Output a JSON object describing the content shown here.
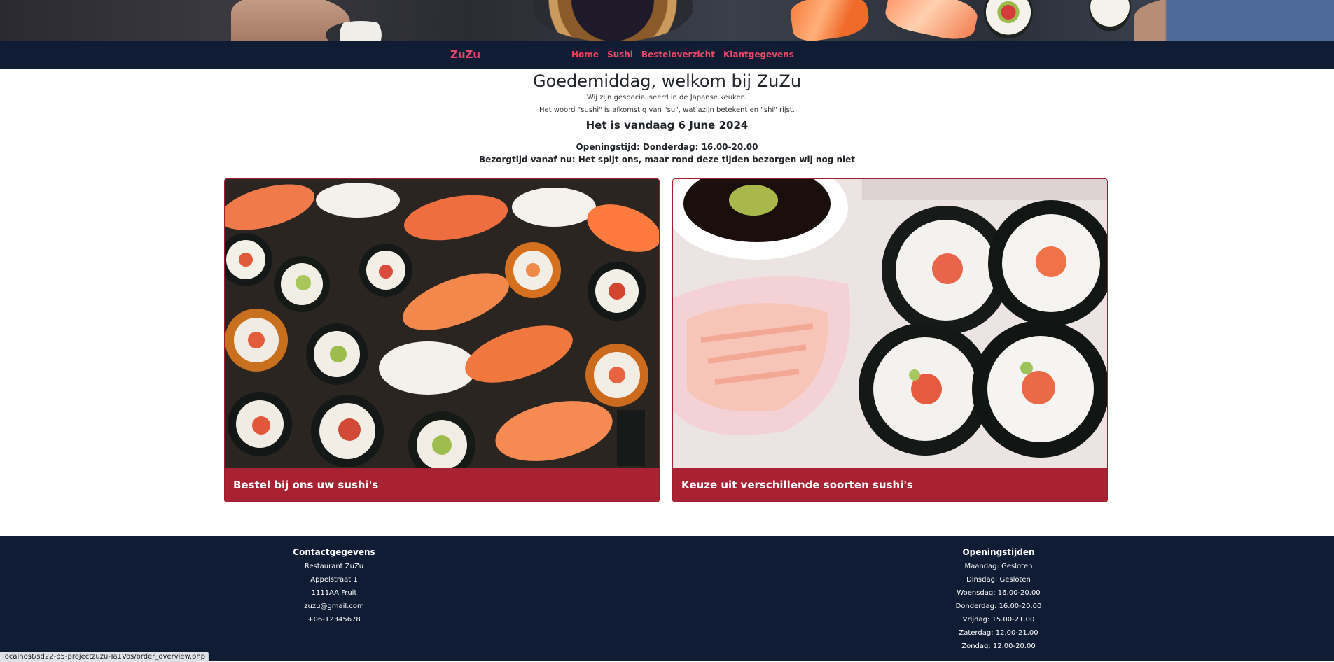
{
  "navbar": {
    "brand": "ZuZu",
    "links": [
      {
        "label": "Home",
        "active": true
      },
      {
        "label": "Sushi",
        "active": false
      },
      {
        "label": "Besteloverzicht",
        "active": false
      },
      {
        "label": "Klantgegevens",
        "active": false
      }
    ]
  },
  "intro": {
    "greeting": "Goedemiddag, welkom bij ZuZu",
    "line1": "Wij zijn gespecialiseerd in de Japanse keuken.",
    "line2": "Het woord \"sushi\" is afkomstig van \"su\", wat azijn betekent en \"shi\" rijst.",
    "date": "Het is vandaag 6 June 2024",
    "opening": "Openingstijd: Donderdag: 16.00-20.00",
    "delivery": "Bezorgtijd vanaf nu: Het spijt ons, maar rond deze tijden bezorgen wij nog niet"
  },
  "cards": [
    {
      "caption": "Bestel bij ons uw sushi's"
    },
    {
      "caption": "Keuze uit verschillende soorten sushi's"
    }
  ],
  "footer": {
    "contact": {
      "heading": "Contactgegevens",
      "lines": [
        "Restaurant ZuZu",
        "Appelstraat 1",
        "1111AA Fruit",
        "zuzu@gmail.com",
        "+06-12345678"
      ]
    },
    "hours": {
      "heading": "Openingstijden",
      "lines": [
        "Maandag: Gesloten",
        "Dinsdag: Gesloten",
        "Woensdag: 16.00-20.00",
        "Donderdag: 16.00-20.00",
        "Vrijdag: 15.00-21.00",
        "Zaterdag: 12.00-21.00",
        "Zondag: 12.00-20.00"
      ]
    }
  },
  "statusbar": {
    "url": "localhost/sd22-p5-projectzuzu-Ta1Vos/order_overview.php"
  },
  "colors": {
    "navbar_bg": "#0f1c33",
    "brand_pink": "#e8476a",
    "card_caption_bg": "#a82233"
  }
}
